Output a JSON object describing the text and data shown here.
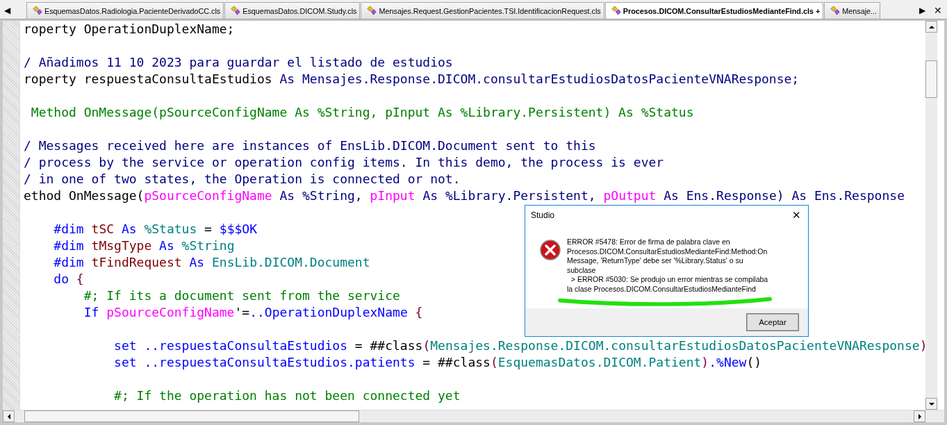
{
  "tabs": [
    {
      "label": "EsquemasDatos.Radiologia.PacienteDerivadoCC.cls",
      "selected": false
    },
    {
      "label": "EsquemasDatos.DICOM.Study.cls",
      "selected": false
    },
    {
      "label": "Mensajes.Request.GestionPacientes.TSI.IdentificacionRequest.cls",
      "selected": false
    },
    {
      "label": "Procesos.DICOM.ConsultarEstudiosMedianteFind.cls +",
      "selected": true
    },
    {
      "label": "Mensaje...",
      "selected": false
    }
  ],
  "tab_scroll_left": "◀",
  "tab_scroll_right": "▶",
  "tab_close": "✕",
  "code_lines": [
    {
      "kind": "code",
      "tokens": [
        {
          "text": "roperty OperationDuplexName;",
          "kind": "plain"
        }
      ]
    },
    {
      "kind": "blank"
    },
    {
      "kind": "code",
      "tokens": [
        {
          "text": "/ Añadimos 11 10 2023 para guardar el listado de estudios",
          "kind": "doc"
        }
      ]
    },
    {
      "kind": "code",
      "tokens": [
        {
          "text": "roperty respuestaConsultaEstudios",
          "kind": "plain"
        },
        {
          "text": " As Mensajes.Response.DICOM.consultarEstudiosDatosPacienteVNAResponse;",
          "kind": "doc"
        }
      ]
    },
    {
      "kind": "blank"
    },
    {
      "kind": "code",
      "tokens": [
        {
          "text": " Method OnMessage(pSourceConfigName As %String, pInput As %Library.Persistent) As %Status",
          "kind": "comment"
        }
      ]
    },
    {
      "kind": "blank"
    },
    {
      "kind": "code",
      "tokens": [
        {
          "text": "/ Messages received here are instances of EnsLib.DICOM.Document sent to this",
          "kind": "doc"
        }
      ]
    },
    {
      "kind": "code",
      "tokens": [
        {
          "text": "/ process by the service or operation config items. In this demo, the process is ever",
          "kind": "doc"
        }
      ]
    },
    {
      "kind": "code",
      "tokens": [
        {
          "text": "/ in one of two states, the Operation is connected or not.",
          "kind": "doc"
        }
      ]
    },
    {
      "kind": "code",
      "tokens": [
        {
          "text": "ethod OnMessage(",
          "kind": "plain"
        },
        {
          "text": "pSourceConfigName",
          "kind": "param"
        },
        {
          "text": " As %String, ",
          "kind": "doc"
        },
        {
          "text": "pInput",
          "kind": "param"
        },
        {
          "text": " As %Library.Persistent, ",
          "kind": "doc"
        },
        {
          "text": "pOutput",
          "kind": "param"
        },
        {
          "text": " As Ens.Response) As Ens.Response",
          "kind": "doc"
        }
      ]
    },
    {
      "kind": "blank"
    },
    {
      "kind": "code",
      "tokens": [
        {
          "text": "    #dim ",
          "kind": "keyword"
        },
        {
          "text": "tSC",
          "kind": "local"
        },
        {
          "text": " As ",
          "kind": "keyword"
        },
        {
          "text": "%Status",
          "kind": "class"
        },
        {
          "text": " = ",
          "kind": "plain"
        },
        {
          "text": "$$$OK",
          "kind": "keyword"
        }
      ]
    },
    {
      "kind": "code",
      "tokens": [
        {
          "text": "    #dim ",
          "kind": "keyword"
        },
        {
          "text": "tMsgType",
          "kind": "local"
        },
        {
          "text": " As ",
          "kind": "keyword"
        },
        {
          "text": "%String",
          "kind": "class"
        }
      ]
    },
    {
      "kind": "code",
      "tokens": [
        {
          "text": "    #dim ",
          "kind": "keyword"
        },
        {
          "text": "tFindRequest",
          "kind": "local"
        },
        {
          "text": " As ",
          "kind": "keyword"
        },
        {
          "text": "EnsLib.DICOM.Document",
          "kind": "class"
        }
      ]
    },
    {
      "kind": "code",
      "tokens": [
        {
          "text": "    do ",
          "kind": "keyword"
        },
        {
          "text": "{",
          "kind": "brace"
        }
      ]
    },
    {
      "kind": "code",
      "tokens": [
        {
          "text": "        #; If its a document sent from the service",
          "kind": "comment"
        }
      ]
    },
    {
      "kind": "code",
      "tokens": [
        {
          "text": "        If ",
          "kind": "keyword"
        },
        {
          "text": "pSourceConfigName",
          "kind": "param"
        },
        {
          "text": "'=",
          "kind": "plain"
        },
        {
          "text": "..OperationDuplexName ",
          "kind": "keyword"
        },
        {
          "text": "{",
          "kind": "brace"
        }
      ]
    },
    {
      "kind": "blank"
    },
    {
      "kind": "code",
      "tokens": [
        {
          "text": "            set ..respuestaConsultaEstudios ",
          "kind": "keyword"
        },
        {
          "text": "= ##class",
          "kind": "plain"
        },
        {
          "text": "(",
          "kind": "brace"
        },
        {
          "text": "Mensajes.Response.DICOM.consultarEstudiosDatosPacienteVNAResponse",
          "kind": "class"
        },
        {
          "text": ")",
          "kind": "brace"
        }
      ]
    },
    {
      "kind": "code",
      "tokens": [
        {
          "text": "            set ..respuestaConsultaEstudios.patients ",
          "kind": "keyword"
        },
        {
          "text": "= ##class",
          "kind": "plain"
        },
        {
          "text": "(",
          "kind": "brace"
        },
        {
          "text": "EsquemasDatos.DICOM.Patient",
          "kind": "class"
        },
        {
          "text": ")",
          "kind": "brace"
        },
        {
          "text": ".%New",
          "kind": "keyword"
        },
        {
          "text": "()",
          "kind": "plain"
        }
      ]
    },
    {
      "kind": "blank"
    },
    {
      "kind": "code",
      "tokens": [
        {
          "text": "            #; If the operation has not been connected yet",
          "kind": "comment"
        }
      ]
    }
  ],
  "dialog": {
    "title": "Studio",
    "close": "✕",
    "message_lines": [
      "ERROR #5478: Error de firma de palabra clave en",
      "Procesos.DICOM.ConsultarEstudiosMedianteFind:Method:On",
      "Message, 'ReturnType' debe ser '%Library.Status' o su",
      "subclase",
      "  > ERROR #5030: Se produjo un error mientras se compilaba",
      "la clase Procesos.DICOM.ConsultarEstudiosMedianteFind"
    ],
    "button": "Aceptar"
  }
}
